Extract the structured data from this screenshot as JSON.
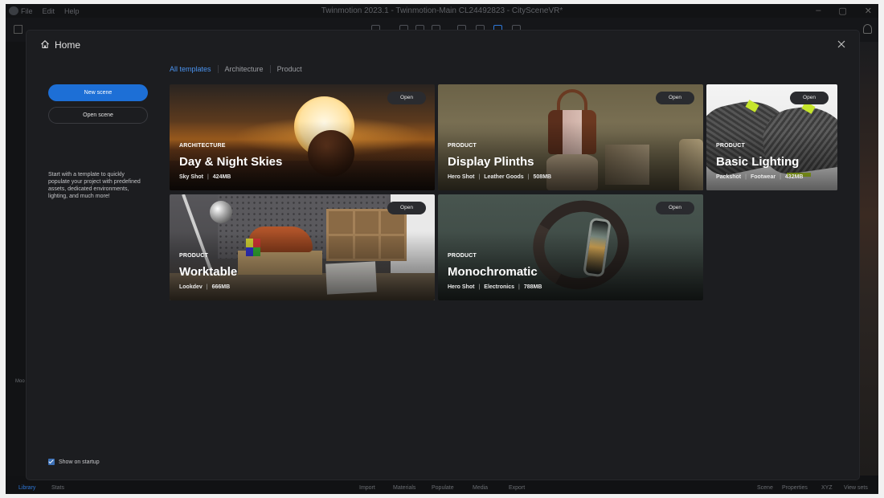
{
  "app": {
    "title": "Twinmotion 2023.1 - Twinmotion-Main CL24492823 - CitySceneVR*",
    "menu": [
      "File",
      "Edit",
      "Help"
    ],
    "left_labels": [
      "Moo"
    ],
    "bottom_items": [
      "Library",
      "Stats",
      "Import",
      "Materials",
      "Populate",
      "Media",
      "Export",
      "Scene",
      "Properties",
      "XYZ",
      "View sets"
    ]
  },
  "modal": {
    "title": "Home",
    "new_scene": "New scene",
    "open_scene": "Open scene",
    "description": "Start with a template to quickly populate your project with predefined assets, dedicated environments, lighting, and much more!",
    "show_on_startup": "Show on startup",
    "show_on_startup_checked": true,
    "tabs": [
      {
        "label": "All templates",
        "active": true
      },
      {
        "label": "Architecture",
        "active": false
      },
      {
        "label": "Product",
        "active": false
      }
    ],
    "open_label": "Open",
    "templates": [
      {
        "category": "ARCHITECTURE",
        "title": "Day & Night Skies",
        "tags": [
          "Sky Shot"
        ],
        "size": "424MB"
      },
      {
        "category": "PRODUCT",
        "title": "Display Plinths",
        "tags": [
          "Hero Shot",
          "Leather Goods"
        ],
        "size": "508MB"
      },
      {
        "category": "PRODUCT",
        "title": "Basic Lighting",
        "tags": [
          "Packshot",
          "Footwear"
        ],
        "size": "432MB"
      },
      {
        "category": "PRODUCT",
        "title": "Worktable",
        "tags": [
          "Lookdev"
        ],
        "size": "666MB"
      },
      {
        "category": "PRODUCT",
        "title": "Monochromatic",
        "tags": [
          "Hero Shot",
          "Electronics"
        ],
        "size": "788MB"
      }
    ]
  }
}
